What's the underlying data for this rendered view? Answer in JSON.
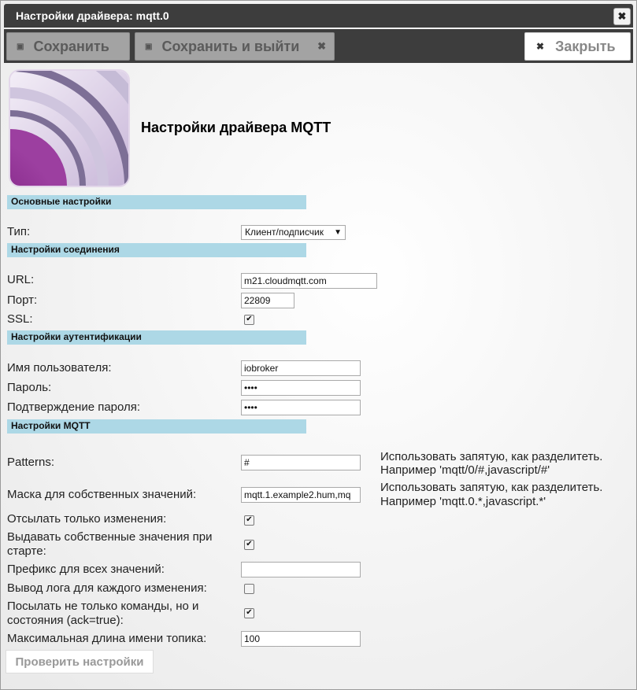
{
  "window": {
    "title": "Настройки драйвера: mqtt.0",
    "close_glyph": "✖"
  },
  "toolbar": {
    "save_label": "Сохранить",
    "save_exit_label": "Сохранить и выйти",
    "close_label": "Закрыть"
  },
  "heading": "Настройки драйвера MQTT",
  "sections": {
    "main": "Основные настройки",
    "connection": "Настройки соединения",
    "auth": "Настройки аутентификации",
    "mqtt": "Настройки MQTT"
  },
  "fields": {
    "type": {
      "label": "Тип:",
      "value": "Клиент/подписчик"
    },
    "url": {
      "label": "URL:",
      "value": "m21.cloudmqtt.com"
    },
    "port": {
      "label": "Порт:",
      "value": "22809"
    },
    "ssl": {
      "label": "SSL:",
      "checked": true
    },
    "username": {
      "label": "Имя пользователя:",
      "value": "iobroker"
    },
    "password": {
      "label": "Пароль:",
      "value": "••••"
    },
    "password_confirm": {
      "label": "Подтверждение пароля:",
      "value": "••••"
    },
    "patterns": {
      "label": "Patterns:",
      "value": "#",
      "hint1": "Использовать запятую, как разделитеть.",
      "hint2": "Например 'mqtt/0/#,javascript/#'"
    },
    "mask": {
      "label": "Маска для собственных значений:",
      "value": "mqtt.1.example2.hum,mq",
      "hint1": "Использовать запятую, как разделитеть.",
      "hint2": "Например 'mqtt.0.*,javascript.*'"
    },
    "only_changes": {
      "label": "Отсылать только изменения:",
      "checked": true
    },
    "publish_on_start": {
      "label1": "Выдавать собственные значения при",
      "label2": "старте:",
      "checked": true
    },
    "prefix": {
      "label": "Префикс для всех значений:",
      "value": ""
    },
    "debug_log": {
      "label": "Вывод лога для каждого изменения:",
      "checked": false
    },
    "send_ack": {
      "label1": "Посылать не только команды, но и",
      "label2": "состояния (ack=true):",
      "checked": true
    },
    "max_topic_length": {
      "label": "Максимальная длина имени топика:",
      "value": "100"
    }
  },
  "check_button": "Проверить настройки",
  "icons": {
    "save": "floppy-icon",
    "close": "close-icon",
    "checkmark": "✔"
  },
  "colors": {
    "titlebar": "#3d3d3d",
    "section": "#add8e6"
  }
}
